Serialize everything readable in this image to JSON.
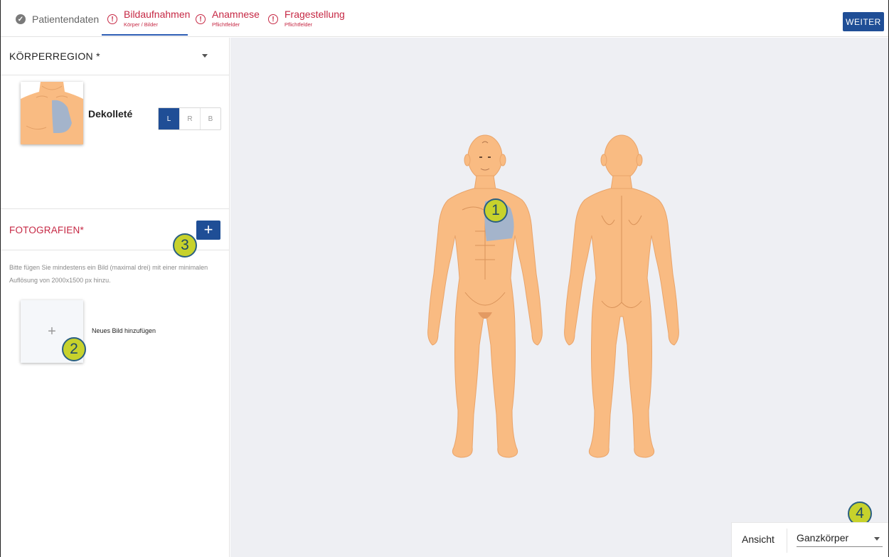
{
  "steps": [
    {
      "label": "Patientendaten",
      "sub": "",
      "status": "done"
    },
    {
      "label": "Bildaufnahmen",
      "sub": "Körper / Bilder",
      "status": "warning"
    },
    {
      "label": "Anamnese",
      "sub": "Pflichtfelder",
      "status": "warning"
    },
    {
      "label": "Fragestellung",
      "sub": "Pflichtfelder",
      "status": "warning"
    }
  ],
  "warn_glyph": "!",
  "done_glyph": "✓",
  "next_button": "WEITER",
  "region": {
    "title": "KÖRPERREGION *",
    "selected": "Dekolleté",
    "sides": [
      "L",
      "R",
      "B"
    ],
    "active_side": "L"
  },
  "photos": {
    "title": "FOTOGRAFIEN*",
    "add_glyph": "+",
    "hint": "Bitte fügen Sie mindestens ein Bild (maximal drei) mit einer minimalen Auflösung von 2000x1500 px hinzu.",
    "new_image_glyph": "+",
    "new_image_label": "Neues Bild hinzufügen"
  },
  "markers": [
    "1",
    "2",
    "3",
    "4"
  ],
  "view": {
    "label": "Ansicht",
    "value": "Ganzkörper"
  },
  "colors": {
    "primary": "#1f4e96",
    "warning": "#c62844",
    "skin": "#f9bb82",
    "highlight": "#a4b4cb",
    "marker": "#c7d22c"
  }
}
